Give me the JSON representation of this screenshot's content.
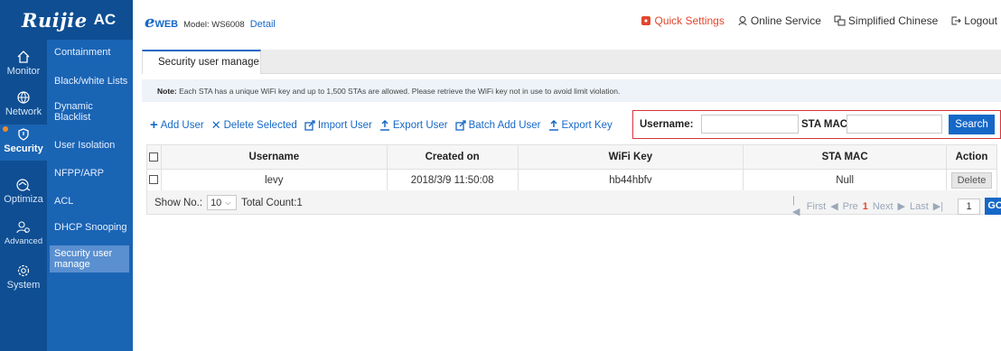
{
  "brand": {
    "logo": "Ruijie",
    "product": "AC"
  },
  "header": {
    "eweb_e": "e",
    "eweb_web": "WEB",
    "model": "Model: WS6008",
    "detail": "Detail",
    "quick_settings": "Quick Settings",
    "online_service": "Online Service",
    "language": "Simplified Chinese",
    "logout": "Logout"
  },
  "nav": {
    "items": [
      {
        "label": "Monitor",
        "icon": "home-icon"
      },
      {
        "label": "Network",
        "icon": "globe-icon"
      },
      {
        "label": "Security",
        "icon": "shield-icon"
      },
      {
        "label": "Optimiza",
        "icon": "optimize-icon"
      },
      {
        "label": "Advanced",
        "icon": "users-gear-icon"
      },
      {
        "label": "System",
        "icon": "gear-icon"
      }
    ]
  },
  "subnav": {
    "items": [
      "Containment",
      "Black/white Lists",
      "Dynamic Blacklist",
      "User Isolation",
      "NFPP/ARP",
      "ACL",
      "DHCP Snooping",
      "Security user manage"
    ]
  },
  "tab": {
    "label": "Security user manage"
  },
  "note": {
    "prefix": "Note:",
    "text": " Each STA has a unique WiFi key and up to 1,500 STAs are allowed. Please retrieve the WiFi key not in use to avoid limit violation."
  },
  "toolbar": {
    "add_user": "Add User",
    "delete_selected": "Delete Selected",
    "import_user": "Import User",
    "export_user": "Export User",
    "batch_add_user": "Batch Add User",
    "export_key": "Export Key"
  },
  "search": {
    "username_label": "Username:",
    "username_value": "",
    "sta_mac_label": "STA MAC:",
    "sta_mac_value": "",
    "button": "Search"
  },
  "table": {
    "columns": [
      "Username",
      "Created on",
      "WiFi Key",
      "STA MAC",
      "Action"
    ],
    "rows": [
      {
        "username": "levy",
        "created_on": "2018/3/9 11:50:08",
        "wifi_key": "hb44hbfv",
        "sta_mac": "Null",
        "action": "Delete"
      }
    ]
  },
  "pager": {
    "show_no_label": "Show No.:",
    "page_size": "10",
    "total_count": "Total Count:1",
    "first": "First",
    "pre": "Pre",
    "current_page": "1",
    "next": "Next",
    "last": "Last",
    "page_input": "1",
    "go": "GO"
  },
  "colors": {
    "accent": "#1668c7",
    "nav_bg": "#0f4e92",
    "quick_settings": "#e2462c",
    "search_frame": "#d8343b"
  }
}
